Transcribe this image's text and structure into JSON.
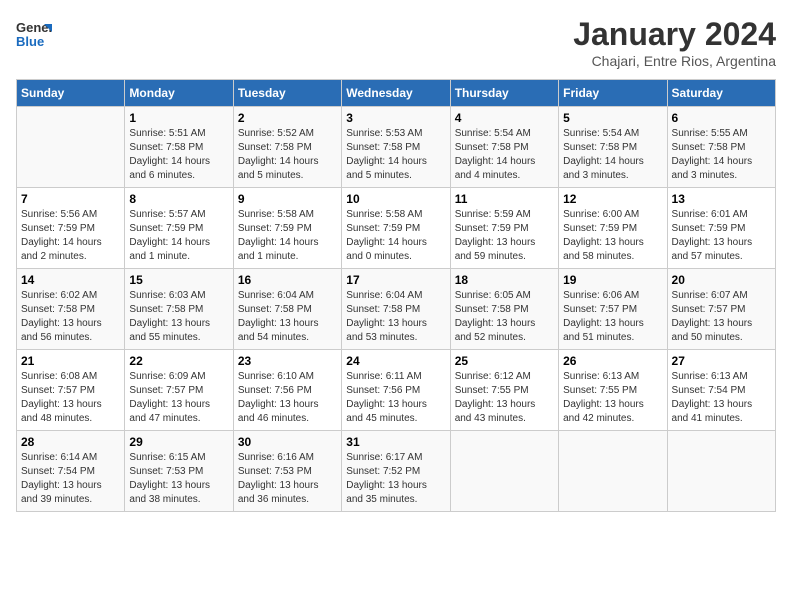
{
  "header": {
    "logo_general": "General",
    "logo_blue": "Blue",
    "month_title": "January 2024",
    "subtitle": "Chajari, Entre Rios, Argentina"
  },
  "weekdays": [
    "Sunday",
    "Monday",
    "Tuesday",
    "Wednesday",
    "Thursday",
    "Friday",
    "Saturday"
  ],
  "weeks": [
    [
      {
        "day": "",
        "sunrise": "",
        "sunset": "",
        "daylight": ""
      },
      {
        "day": "1",
        "sunrise": "Sunrise: 5:51 AM",
        "sunset": "Sunset: 7:58 PM",
        "daylight": "Daylight: 14 hours and 6 minutes."
      },
      {
        "day": "2",
        "sunrise": "Sunrise: 5:52 AM",
        "sunset": "Sunset: 7:58 PM",
        "daylight": "Daylight: 14 hours and 5 minutes."
      },
      {
        "day": "3",
        "sunrise": "Sunrise: 5:53 AM",
        "sunset": "Sunset: 7:58 PM",
        "daylight": "Daylight: 14 hours and 5 minutes."
      },
      {
        "day": "4",
        "sunrise": "Sunrise: 5:54 AM",
        "sunset": "Sunset: 7:58 PM",
        "daylight": "Daylight: 14 hours and 4 minutes."
      },
      {
        "day": "5",
        "sunrise": "Sunrise: 5:54 AM",
        "sunset": "Sunset: 7:58 PM",
        "daylight": "Daylight: 14 hours and 3 minutes."
      },
      {
        "day": "6",
        "sunrise": "Sunrise: 5:55 AM",
        "sunset": "Sunset: 7:58 PM",
        "daylight": "Daylight: 14 hours and 3 minutes."
      }
    ],
    [
      {
        "day": "7",
        "sunrise": "Sunrise: 5:56 AM",
        "sunset": "Sunset: 7:59 PM",
        "daylight": "Daylight: 14 hours and 2 minutes."
      },
      {
        "day": "8",
        "sunrise": "Sunrise: 5:57 AM",
        "sunset": "Sunset: 7:59 PM",
        "daylight": "Daylight: 14 hours and 1 minute."
      },
      {
        "day": "9",
        "sunrise": "Sunrise: 5:58 AM",
        "sunset": "Sunset: 7:59 PM",
        "daylight": "Daylight: 14 hours and 1 minute."
      },
      {
        "day": "10",
        "sunrise": "Sunrise: 5:58 AM",
        "sunset": "Sunset: 7:59 PM",
        "daylight": "Daylight: 14 hours and 0 minutes."
      },
      {
        "day": "11",
        "sunrise": "Sunrise: 5:59 AM",
        "sunset": "Sunset: 7:59 PM",
        "daylight": "Daylight: 13 hours and 59 minutes."
      },
      {
        "day": "12",
        "sunrise": "Sunrise: 6:00 AM",
        "sunset": "Sunset: 7:59 PM",
        "daylight": "Daylight: 13 hours and 58 minutes."
      },
      {
        "day": "13",
        "sunrise": "Sunrise: 6:01 AM",
        "sunset": "Sunset: 7:59 PM",
        "daylight": "Daylight: 13 hours and 57 minutes."
      }
    ],
    [
      {
        "day": "14",
        "sunrise": "Sunrise: 6:02 AM",
        "sunset": "Sunset: 7:58 PM",
        "daylight": "Daylight: 13 hours and 56 minutes."
      },
      {
        "day": "15",
        "sunrise": "Sunrise: 6:03 AM",
        "sunset": "Sunset: 7:58 PM",
        "daylight": "Daylight: 13 hours and 55 minutes."
      },
      {
        "day": "16",
        "sunrise": "Sunrise: 6:04 AM",
        "sunset": "Sunset: 7:58 PM",
        "daylight": "Daylight: 13 hours and 54 minutes."
      },
      {
        "day": "17",
        "sunrise": "Sunrise: 6:04 AM",
        "sunset": "Sunset: 7:58 PM",
        "daylight": "Daylight: 13 hours and 53 minutes."
      },
      {
        "day": "18",
        "sunrise": "Sunrise: 6:05 AM",
        "sunset": "Sunset: 7:58 PM",
        "daylight": "Daylight: 13 hours and 52 minutes."
      },
      {
        "day": "19",
        "sunrise": "Sunrise: 6:06 AM",
        "sunset": "Sunset: 7:57 PM",
        "daylight": "Daylight: 13 hours and 51 minutes."
      },
      {
        "day": "20",
        "sunrise": "Sunrise: 6:07 AM",
        "sunset": "Sunset: 7:57 PM",
        "daylight": "Daylight: 13 hours and 50 minutes."
      }
    ],
    [
      {
        "day": "21",
        "sunrise": "Sunrise: 6:08 AM",
        "sunset": "Sunset: 7:57 PM",
        "daylight": "Daylight: 13 hours and 48 minutes."
      },
      {
        "day": "22",
        "sunrise": "Sunrise: 6:09 AM",
        "sunset": "Sunset: 7:57 PM",
        "daylight": "Daylight: 13 hours and 47 minutes."
      },
      {
        "day": "23",
        "sunrise": "Sunrise: 6:10 AM",
        "sunset": "Sunset: 7:56 PM",
        "daylight": "Daylight: 13 hours and 46 minutes."
      },
      {
        "day": "24",
        "sunrise": "Sunrise: 6:11 AM",
        "sunset": "Sunset: 7:56 PM",
        "daylight": "Daylight: 13 hours and 45 minutes."
      },
      {
        "day": "25",
        "sunrise": "Sunrise: 6:12 AM",
        "sunset": "Sunset: 7:55 PM",
        "daylight": "Daylight: 13 hours and 43 minutes."
      },
      {
        "day": "26",
        "sunrise": "Sunrise: 6:13 AM",
        "sunset": "Sunset: 7:55 PM",
        "daylight": "Daylight: 13 hours and 42 minutes."
      },
      {
        "day": "27",
        "sunrise": "Sunrise: 6:13 AM",
        "sunset": "Sunset: 7:54 PM",
        "daylight": "Daylight: 13 hours and 41 minutes."
      }
    ],
    [
      {
        "day": "28",
        "sunrise": "Sunrise: 6:14 AM",
        "sunset": "Sunset: 7:54 PM",
        "daylight": "Daylight: 13 hours and 39 minutes."
      },
      {
        "day": "29",
        "sunrise": "Sunrise: 6:15 AM",
        "sunset": "Sunset: 7:53 PM",
        "daylight": "Daylight: 13 hours and 38 minutes."
      },
      {
        "day": "30",
        "sunrise": "Sunrise: 6:16 AM",
        "sunset": "Sunset: 7:53 PM",
        "daylight": "Daylight: 13 hours and 36 minutes."
      },
      {
        "day": "31",
        "sunrise": "Sunrise: 6:17 AM",
        "sunset": "Sunset: 7:52 PM",
        "daylight": "Daylight: 13 hours and 35 minutes."
      },
      {
        "day": "",
        "sunrise": "",
        "sunset": "",
        "daylight": ""
      },
      {
        "day": "",
        "sunrise": "",
        "sunset": "",
        "daylight": ""
      },
      {
        "day": "",
        "sunrise": "",
        "sunset": "",
        "daylight": ""
      }
    ]
  ]
}
